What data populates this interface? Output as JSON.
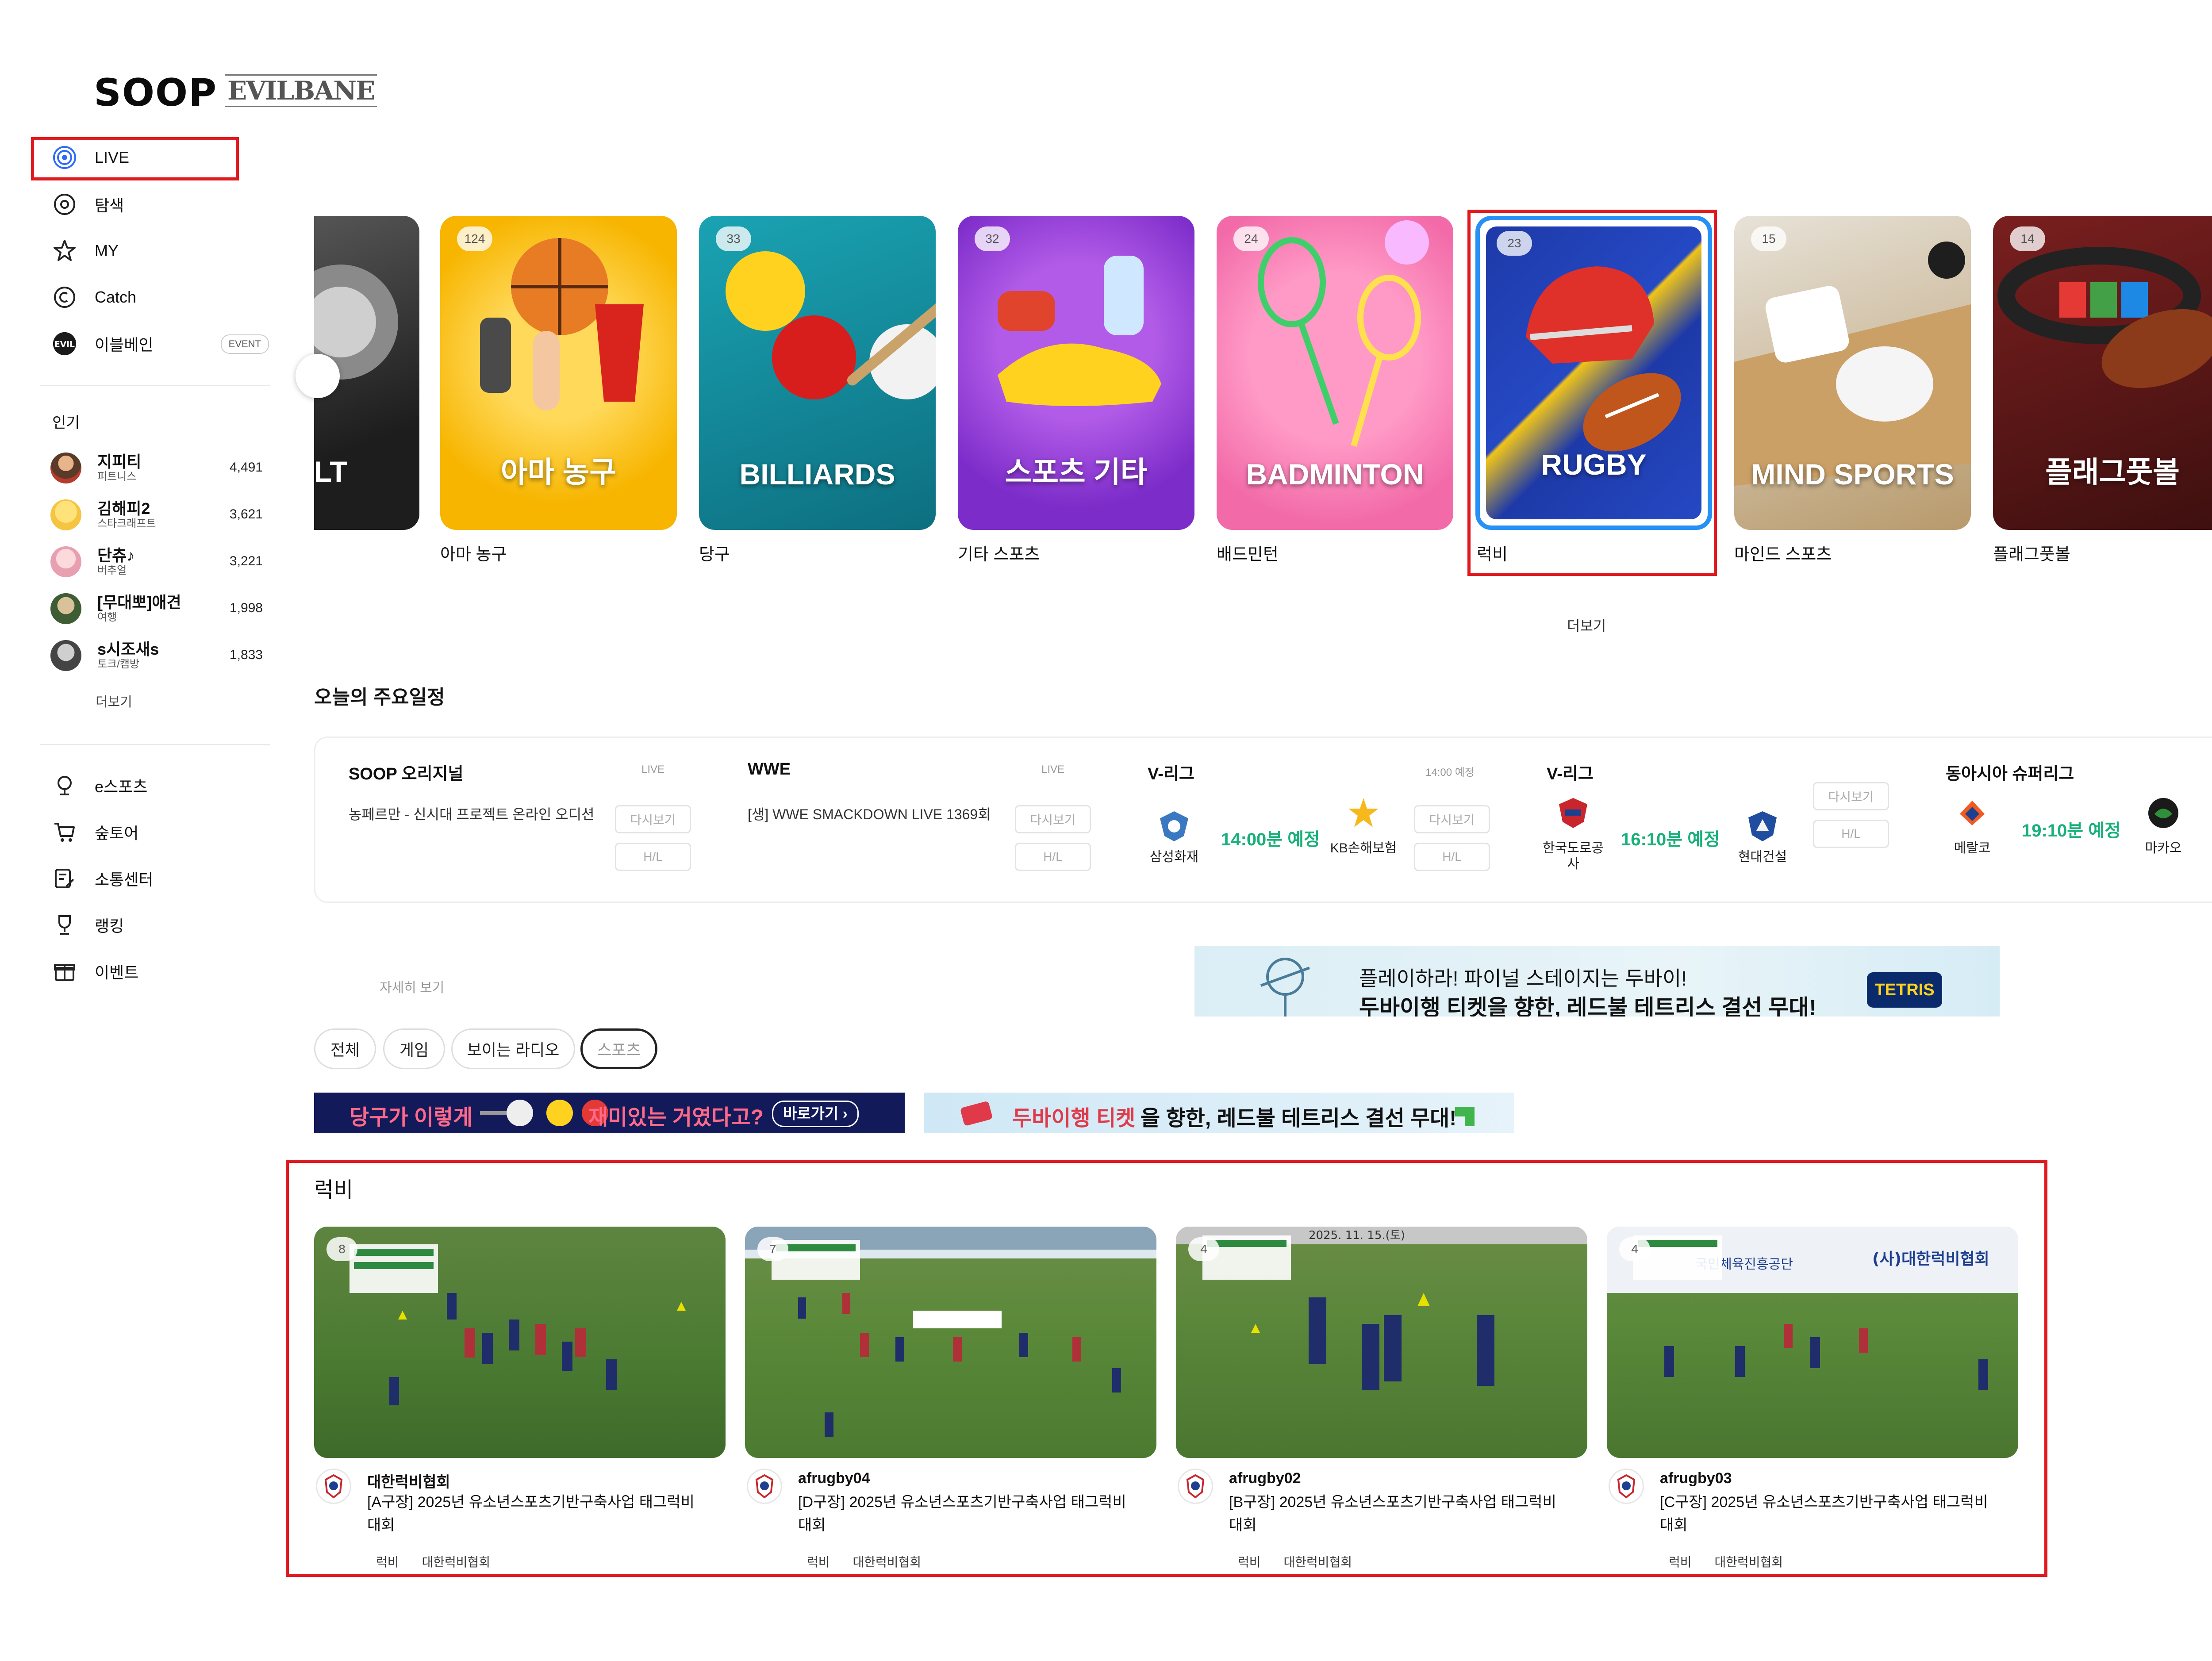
{
  "sidebar": {
    "logo": "SOOP",
    "partner_logo": "EVILBANE",
    "nav": [
      {
        "label": "LIVE",
        "icon": "live-broadcast-icon"
      },
      {
        "label": "탐색",
        "icon": "compass-icon"
      },
      {
        "label": "MY",
        "icon": "star-icon"
      },
      {
        "label": "Catch",
        "icon": "catch-icon"
      },
      {
        "label": "이블베인",
        "icon": "evilbane-logo-icon",
        "badge": "EVENT"
      }
    ],
    "popular_title": "인기",
    "popular": [
      {
        "name": "지피티",
        "category": "피트니스",
        "viewers": "4,491"
      },
      {
        "name": "김해피2",
        "category": "스타크래프트",
        "viewers": "3,621"
      },
      {
        "name": "단츄♪",
        "category": "버추얼",
        "viewers": "3,221"
      },
      {
        "name": "[무대뽀]애견",
        "category": "여행",
        "viewers": "1,998"
      },
      {
        "name": "s시조새s",
        "category": "토크/캠방",
        "viewers": "1,833"
      }
    ],
    "popular_more": "더보기",
    "nav2": [
      {
        "label": "e스포츠",
        "icon": "trophy-esports-icon"
      },
      {
        "label": "숲토어",
        "icon": "cart-icon"
      },
      {
        "label": "소통센터",
        "icon": "edit-note-icon"
      },
      {
        "label": "랭킹",
        "icon": "ranking-trophy-icon"
      },
      {
        "label": "이벤트",
        "icon": "gift-icon"
      }
    ]
  },
  "categories": [
    {
      "partial_text": "LT",
      "label": ""
    },
    {
      "count": "124",
      "title": "아마 농구",
      "label": "아마 농구"
    },
    {
      "count": "33",
      "title": "BILLIARDS",
      "label": "당구"
    },
    {
      "count": "32",
      "title": "스포츠 기타",
      "label": "기타 스포츠"
    },
    {
      "count": "24",
      "title": "BADMINTON",
      "label": "배드민턴"
    },
    {
      "count": "23",
      "title": "RUGBY",
      "label": "럭비"
    },
    {
      "count": "15",
      "title": "MIND SPORTS",
      "label": "마인드 스포츠"
    },
    {
      "count": "14",
      "title": "플래그풋볼",
      "label": "플래그풋볼"
    }
  ],
  "categories_more": "더보기",
  "schedule": {
    "title": "오늘의 주요일정",
    "replay_label": "다시보기",
    "hl_label": "H/L",
    "items": [
      {
        "title": "SOOP 오리지널",
        "tag": "LIVE",
        "desc": "농페르만 - 신시대 프로젝트 온라인 오디션"
      },
      {
        "title": "WWE",
        "tag": "LIVE",
        "desc": "[생] WWE SMACKDOWN LIVE 1369회"
      },
      {
        "title": "V-리그",
        "tag": "14:00 예정",
        "home": "삼성화재",
        "away": "KB손해보험",
        "time": "14:00분 예정"
      },
      {
        "title": "V-리그",
        "home": "한국도로공사",
        "away": "현대건설",
        "time": "16:10분 예정"
      },
      {
        "title": "동아시아 슈퍼리그",
        "home": "메랄코",
        "away": "마카오",
        "time": "19:10분 예정"
      }
    ],
    "detail_link": "자세히 보기"
  },
  "promo_banner": {
    "line1": "플레이하라! 파이널 스테이지는 두바이!",
    "line2": "두바이행 티켓을 향한, 레드불 테트리스 결선 무대!",
    "brand": "TETRIS"
  },
  "filters": [
    "전체",
    "게임",
    "보이는 라디오",
    "스포츠"
  ],
  "ads": [
    {
      "text_a": "당구가 이렇게",
      "text_b": "재미있는 거였다고?",
      "cta": "바로가기 ›"
    },
    {
      "text_a": "두바이행 티켓",
      "text_b": "을 향한, 레드불 테트리스 결선 무대!"
    }
  ],
  "rugby_section": {
    "title": "럭비",
    "streams": [
      {
        "viewers": "8",
        "channel": "대한럭비협회",
        "title": "[A구장] 2025년 유소년스포츠기반구축사업 태그럭비 대회",
        "tags": [
          "럭비",
          "대한럭비협회"
        ]
      },
      {
        "viewers": "7",
        "channel": "afrugby04",
        "title": "[D구장] 2025년 유소년스포츠기반구축사업 태그럭비 대회",
        "tags": [
          "럭비",
          "대한럭비협회"
        ]
      },
      {
        "viewers": "4",
        "channel": "afrugby02",
        "title": "[B구장] 2025년 유소년스포츠기반구축사업 태그럭비 대회",
        "tags": [
          "럭비",
          "대한럭비협회"
        ]
      },
      {
        "viewers": "4",
        "channel": "afrugby03",
        "title": "[C구장] 2025년 유소년스포츠기반구축사업 태그럭비 대회",
        "tags": [
          "럭비",
          "대한럭비협회"
        ]
      }
    ],
    "field_sign_a": "2025. 11. 15.(토)",
    "field_sign_b": "(사)대한럭비협회",
    "field_sign_c": "국민체육진흥공단"
  },
  "colors": {
    "accent": "#2d6cf6",
    "highlight": "#e0191f",
    "time_green": "#18b07a"
  }
}
